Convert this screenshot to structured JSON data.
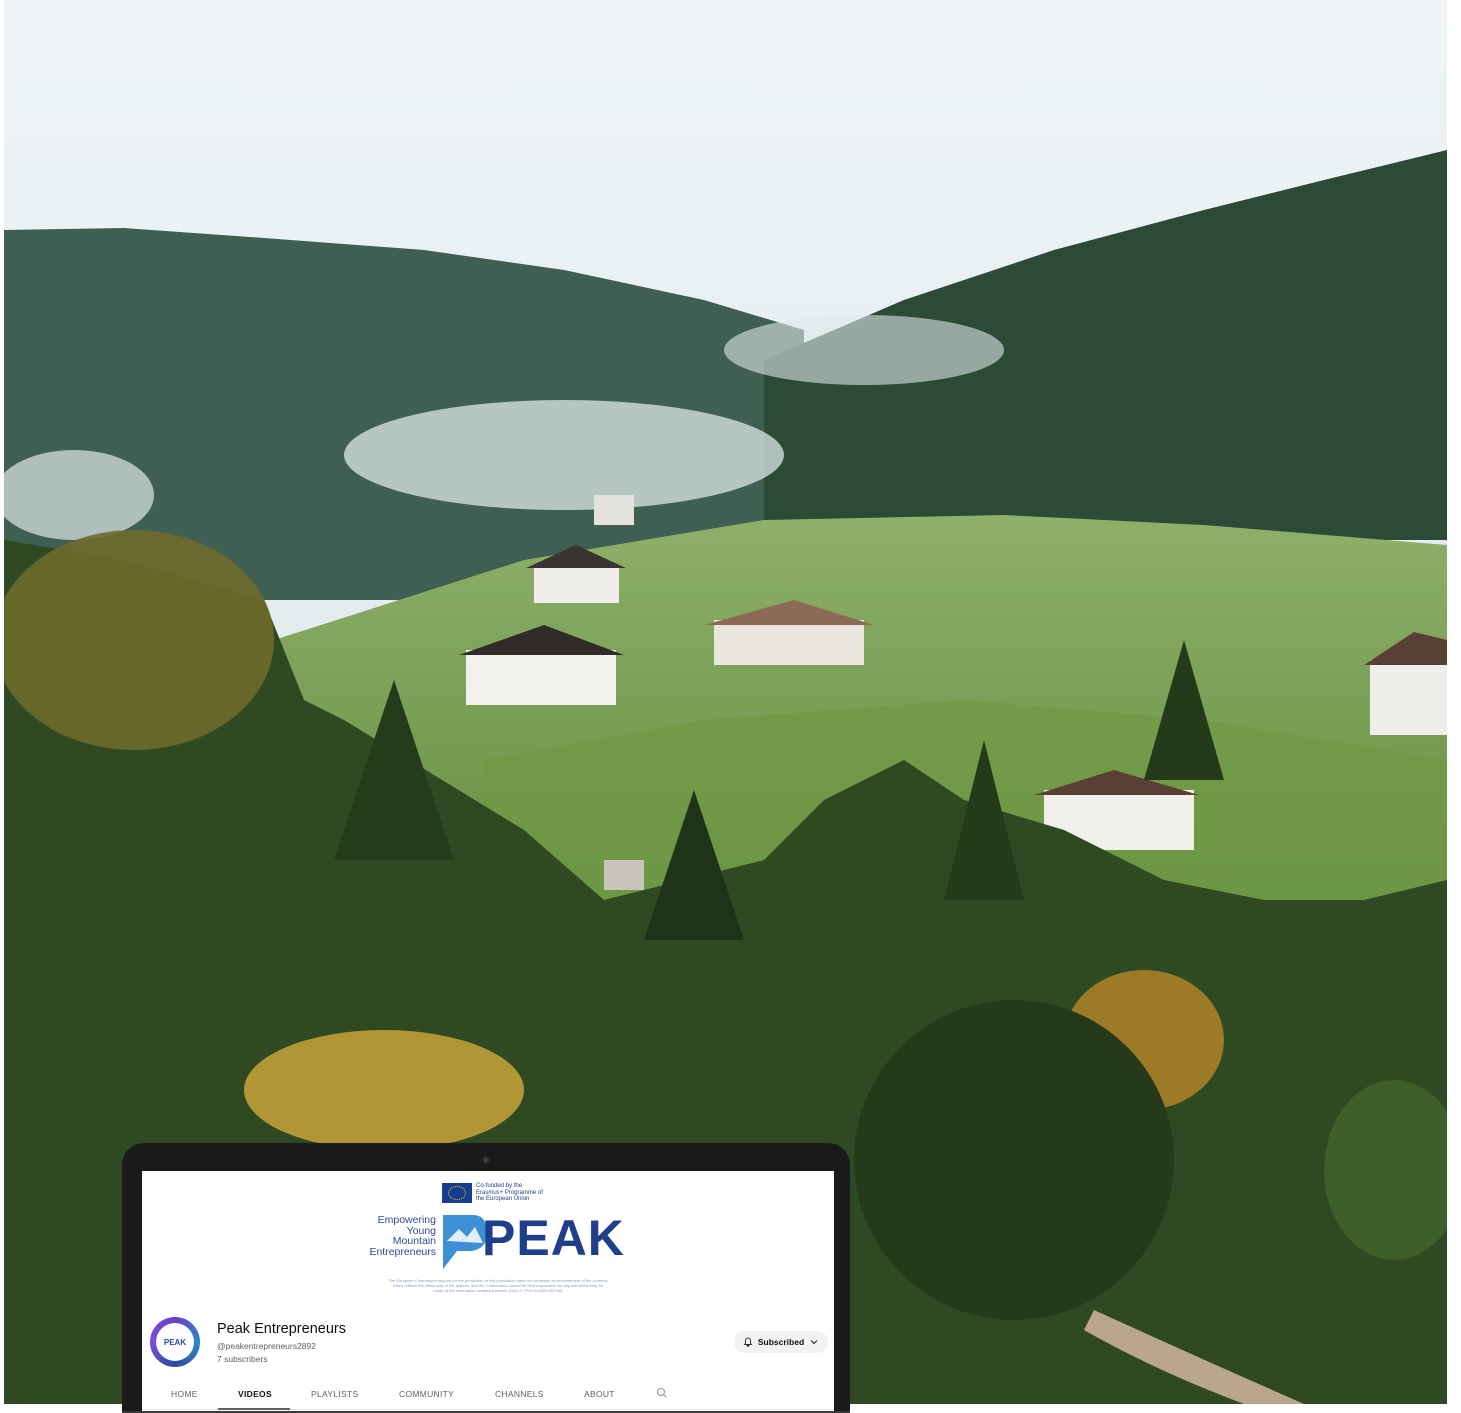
{
  "banner": {
    "eu_cofunding": "Co-funded by the Erasmus+ Programme of the European Union",
    "tagline": [
      "Empowering",
      "Young",
      "Mountain",
      "Entrepreneurs"
    ],
    "logo_word": "PEAK",
    "disclaimer": "The European Commission support for the production of this publication does not constitute an endorsement of the contents which reflects the views only of the authors, and the Commission cannot be held responsible for any use which may be made of the information contained therein (2020-1-TR01-KA205-093738)"
  },
  "channel": {
    "avatar_text": "PEAK",
    "name": "Peak Entrepreneurs",
    "handle": "@peakentrepreneurs2892",
    "subscribers": "7 subscribers",
    "subscribe_button": "Subscribed"
  },
  "tabs": [
    {
      "label": "HOME",
      "active": false
    },
    {
      "label": "VIDEOS",
      "active": true
    },
    {
      "label": "PLAYLISTS",
      "active": false
    },
    {
      "label": "COMMUNITY",
      "active": false
    },
    {
      "label": "CHANNELS",
      "active": false
    },
    {
      "label": "ABOUT",
      "active": false
    }
  ],
  "icons": {
    "search": "search-icon",
    "bell": "bell-icon",
    "chevron": "chevron-down-icon",
    "eu_flag": "eu-flag-icon"
  },
  "colors": {
    "brand_blue": "#1f3f8a",
    "brand_purple": "#6a3fc4"
  }
}
